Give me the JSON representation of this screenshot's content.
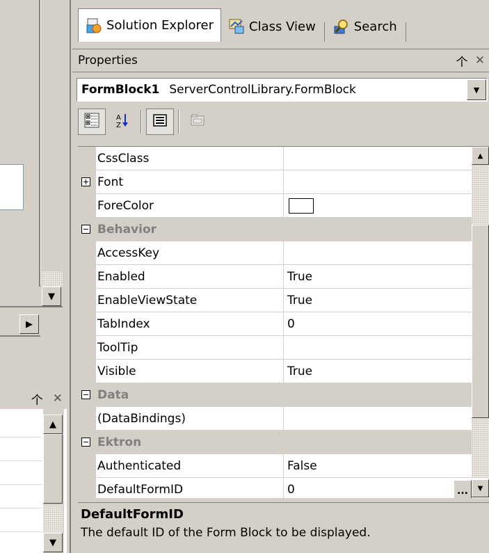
{
  "tabs": [
    {
      "label": "Solution Explorer",
      "icon": "solution-explorer-icon",
      "active": true
    },
    {
      "label": "Class View",
      "icon": "class-view-icon",
      "active": false
    },
    {
      "label": "Search",
      "icon": "search-icon",
      "active": false
    }
  ],
  "panel": {
    "title": "Properties",
    "pin_icon": "pin-icon",
    "close_icon": "close-icon"
  },
  "object_selector": {
    "name": "FormBlock1",
    "type": "ServerControlLibrary.FormBlock"
  },
  "toolbar": {
    "buttons": [
      "categorized-icon",
      "alphabetical-icon",
      "properties-icon",
      "property-pages-icon"
    ]
  },
  "properties": [
    {
      "name": "CssClass",
      "value": ""
    },
    {
      "name": "Font",
      "value": "",
      "expandable": true
    },
    {
      "name": "ForeColor",
      "value": "",
      "color_swatch": "#ffffff"
    },
    {
      "category": "Behavior"
    },
    {
      "name": "AccessKey",
      "value": ""
    },
    {
      "name": "Enabled",
      "value": "True"
    },
    {
      "name": "EnableViewState",
      "value": "True"
    },
    {
      "name": "TabIndex",
      "value": "0"
    },
    {
      "name": "ToolTip",
      "value": ""
    },
    {
      "name": "Visible",
      "value": "True"
    },
    {
      "category": "Data"
    },
    {
      "name": "(DataBindings)",
      "value": ""
    },
    {
      "category": "Ektron"
    },
    {
      "name": "Authenticated",
      "value": "False"
    },
    {
      "name": "DefaultFormID",
      "value": "0",
      "selected": true,
      "ellipsis": "..."
    }
  ],
  "description": {
    "title": "DefaultFormID",
    "text": "The default ID of the Form Block to be displayed."
  },
  "colors": {
    "chrome": "#d4d0c8",
    "shadow": "#808080",
    "category_text": "#808080"
  }
}
